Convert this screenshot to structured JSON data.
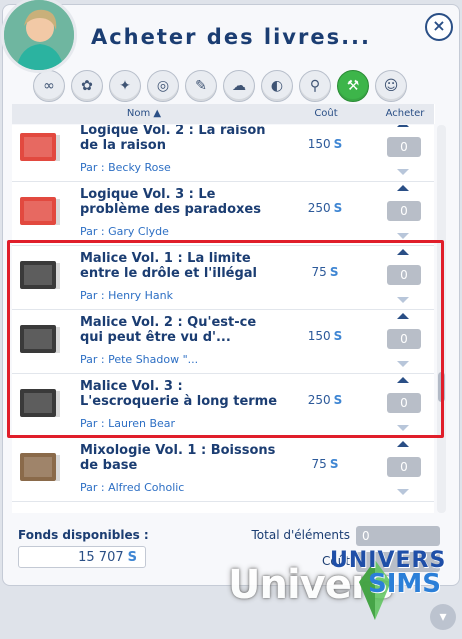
{
  "window": {
    "title": "Acheter des livres..."
  },
  "filters": [
    {
      "icon": "infinity-icon",
      "glyph": "∞",
      "active": false
    },
    {
      "icon": "baby-icon",
      "glyph": "✿",
      "active": false
    },
    {
      "icon": "wand-icon",
      "glyph": "✦",
      "active": false
    },
    {
      "icon": "glasses-icon",
      "glyph": "◎",
      "active": false
    },
    {
      "icon": "feather-icon",
      "glyph": "✎",
      "active": false
    },
    {
      "icon": "cloud-icon",
      "glyph": "☁",
      "active": false
    },
    {
      "icon": "planet-icon",
      "glyph": "◐",
      "active": false
    },
    {
      "icon": "magnifier-icon",
      "glyph": "⚲",
      "active": false
    },
    {
      "icon": "hammer-icon",
      "glyph": "⚒",
      "active": true
    },
    {
      "icon": "smiley-icon",
      "glyph": "☺",
      "active": false
    }
  ],
  "columns": {
    "name": "Nom",
    "cost": "Coût",
    "buy": "Acheter"
  },
  "books": [
    {
      "title": "Logique Vol. 2 : La raison de la raison",
      "author": "Par : Becky Rose",
      "cost": "150",
      "currency": "S",
      "qty": "0",
      "color": "#e2493f"
    },
    {
      "title": "Logique Vol. 3 : Le problème des paradoxes",
      "author": "Par : Gary Clyde",
      "cost": "250",
      "currency": "S",
      "qty": "0",
      "color": "#e2493f"
    },
    {
      "title": "Malice Vol. 1 : La limite entre le drôle et l'illégal",
      "author": "Par : Henry Hank",
      "cost": "75",
      "currency": "S",
      "qty": "0",
      "color": "#3a3a3a"
    },
    {
      "title": "Malice Vol. 2 : Qu'est-ce qui peut être vu d'...",
      "author": "Par : Pete Shadow \"...",
      "cost": "150",
      "currency": "S",
      "qty": "0",
      "color": "#3a3a3a"
    },
    {
      "title": "Malice Vol. 3 : L'escroquerie à long terme",
      "author": "Par : Lauren Bear",
      "cost": "250",
      "currency": "S",
      "qty": "0",
      "color": "#3a3a3a"
    },
    {
      "title": "Mixologie Vol. 1 : Boissons de base",
      "author": "Par : Alfred Coholic",
      "cost": "75",
      "currency": "S",
      "qty": "0",
      "color": "#8a6a4a"
    }
  ],
  "footer": {
    "funds_label": "Fonds disponibles :",
    "funds_value": "15 707",
    "currency": "S",
    "total_label": "Total d'éléments",
    "total_value": "0",
    "cost_label": "Coût"
  },
  "watermark": {
    "text": "Univers",
    "logo_line1": "UNIVERS",
    "logo_line2": "SIMS"
  }
}
